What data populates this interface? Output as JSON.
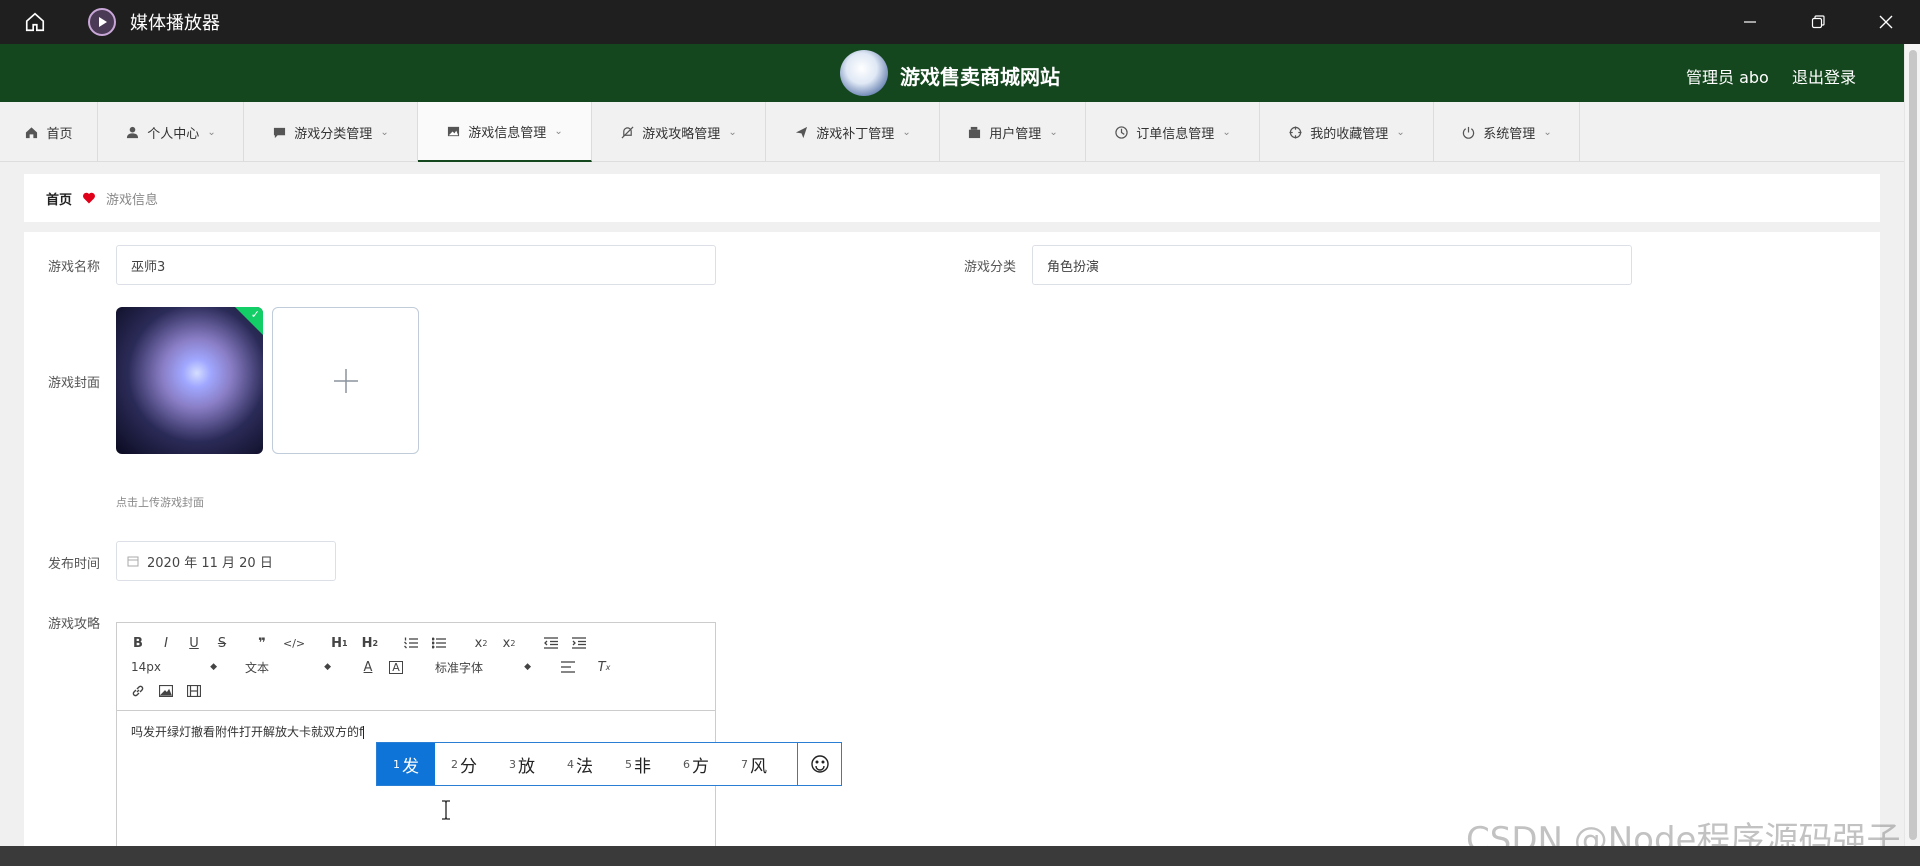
{
  "window": {
    "title": "媒体播放器"
  },
  "site": {
    "title": "游戏售卖商城网站",
    "user_label": "管理员 abo",
    "logout_label": "退出登录"
  },
  "nav": {
    "items": [
      {
        "label": "首页",
        "icon": "home-icon"
      },
      {
        "label": "个人中心",
        "icon": "user-icon"
      },
      {
        "label": "游戏分类管理",
        "icon": "chat-icon"
      },
      {
        "label": "游戏信息管理",
        "icon": "picture-icon"
      },
      {
        "label": "游戏攻略管理",
        "icon": "bell-off-icon"
      },
      {
        "label": "游戏补丁管理",
        "icon": "send-icon"
      },
      {
        "label": "用户管理",
        "icon": "wallet-icon"
      },
      {
        "label": "订单信息管理",
        "icon": "clock-icon"
      },
      {
        "label": "我的收藏管理",
        "icon": "aim-icon"
      },
      {
        "label": "系统管理",
        "icon": "power-icon"
      }
    ]
  },
  "breadcrumb": {
    "home": "首页",
    "current": "游戏信息"
  },
  "form": {
    "name_label": "游戏名称",
    "name_value": "巫师3",
    "category_label": "游戏分类",
    "category_value": "角色扮演",
    "cover_label": "游戏封面",
    "cover_hint": "点击上传游戏封面",
    "date_label": "发布时间",
    "date_value": "2020 年 11 月 20 日",
    "guide_label": "游戏攻略"
  },
  "editor": {
    "font_size": "14px",
    "block_type": "文本",
    "font_family": "标准字体",
    "content": "吗发开绿灯撤看附件打开解放大卡就双方的f"
  },
  "ime": {
    "candidates": [
      {
        "num": "1",
        "text": "发"
      },
      {
        "num": "2",
        "text": "分"
      },
      {
        "num": "3",
        "text": "放"
      },
      {
        "num": "4",
        "text": "法"
      },
      {
        "num": "5",
        "text": "非"
      },
      {
        "num": "6",
        "text": "方"
      },
      {
        "num": "7",
        "text": "风"
      }
    ]
  },
  "watermark": "CSDN @Node程序源码强子",
  "colors": {
    "header_bg": "#15471f",
    "accent_blue": "#0f74d7",
    "success": "#13ce66",
    "heart": "#e0001a"
  }
}
